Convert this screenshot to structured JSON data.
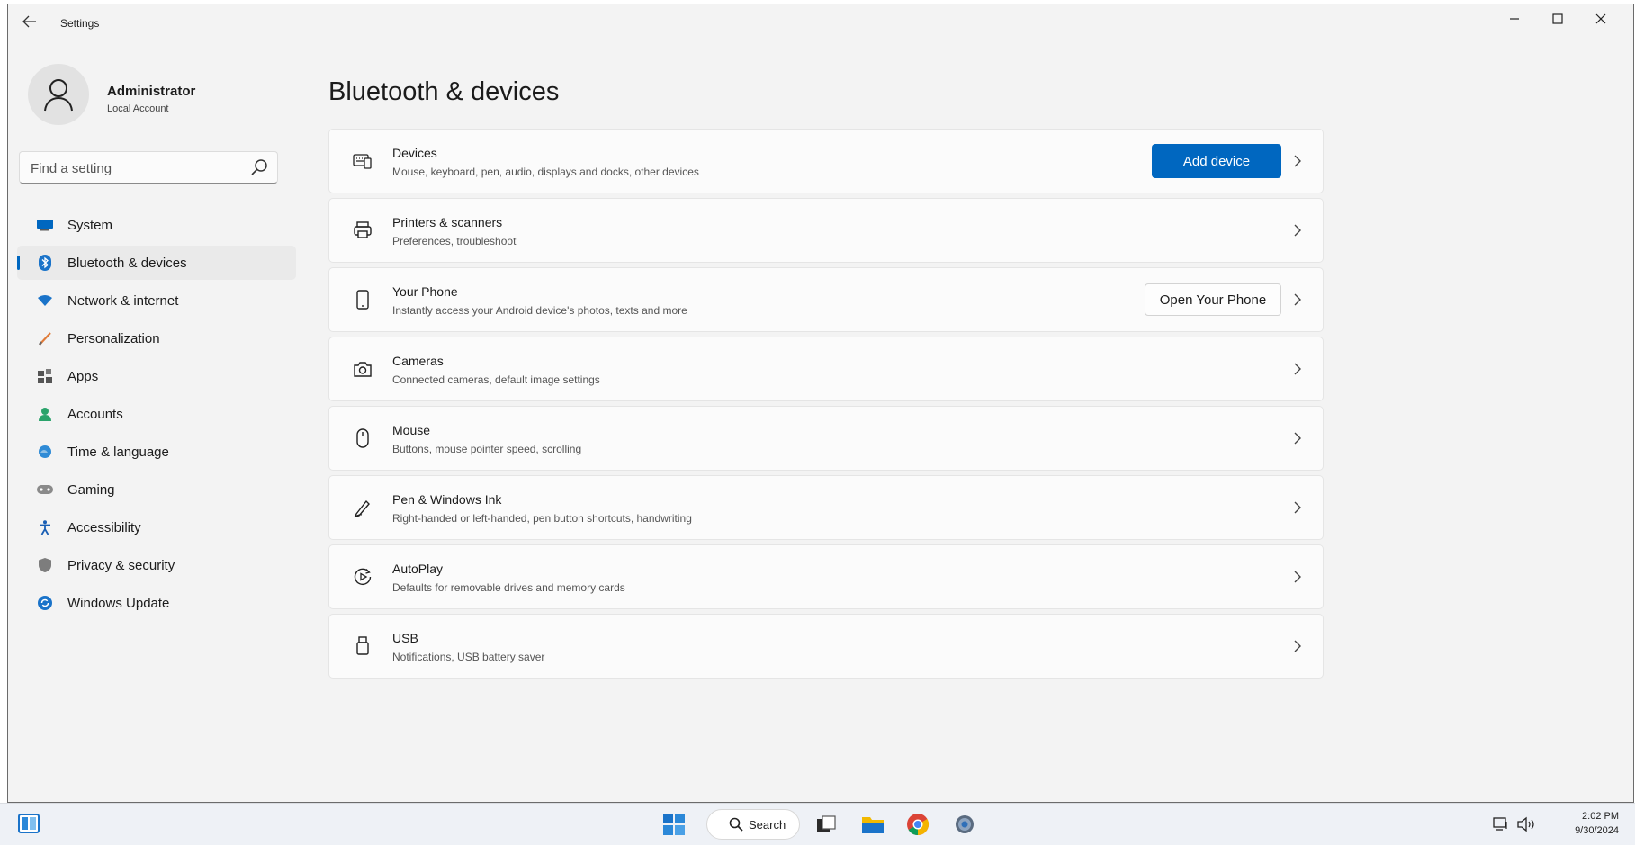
{
  "window": {
    "title": "Settings"
  },
  "profile": {
    "name": "Administrator",
    "subtitle": "Local Account"
  },
  "search": {
    "placeholder": "Find a setting"
  },
  "sidebar": {
    "items": [
      {
        "label": "System",
        "icon": "system-icon",
        "active": false
      },
      {
        "label": "Bluetooth & devices",
        "icon": "bluetooth-icon",
        "active": true
      },
      {
        "label": "Network & internet",
        "icon": "network-icon",
        "active": false
      },
      {
        "label": "Personalization",
        "icon": "personalization-icon",
        "active": false
      },
      {
        "label": "Apps",
        "icon": "apps-icon",
        "active": false
      },
      {
        "label": "Accounts",
        "icon": "accounts-icon",
        "active": false
      },
      {
        "label": "Time & language",
        "icon": "time-language-icon",
        "active": false
      },
      {
        "label": "Gaming",
        "icon": "gaming-icon",
        "active": false
      },
      {
        "label": "Accessibility",
        "icon": "accessibility-icon",
        "active": false
      },
      {
        "label": "Privacy & security",
        "icon": "privacy-icon",
        "active": false
      },
      {
        "label": "Windows Update",
        "icon": "windows-update-icon",
        "active": false
      }
    ]
  },
  "main": {
    "title": "Bluetooth & devices",
    "cards": [
      {
        "title": "Devices",
        "desc": "Mouse, keyboard, pen, audio, displays and docks, other devices",
        "icon": "devices-icon",
        "button": "Add device"
      },
      {
        "title": "Printers & scanners",
        "desc": "Preferences, troubleshoot",
        "icon": "printer-icon"
      },
      {
        "title": "Your Phone",
        "desc": "Instantly access your Android device's photos, texts and more",
        "icon": "phone-icon",
        "button": "Open Your Phone"
      },
      {
        "title": "Cameras",
        "desc": "Connected cameras, default image settings",
        "icon": "camera-icon"
      },
      {
        "title": "Mouse",
        "desc": "Buttons, mouse pointer speed, scrolling",
        "icon": "mouse-icon"
      },
      {
        "title": "Pen & Windows Ink",
        "desc": "Right-handed or left-handed, pen button shortcuts, handwriting",
        "icon": "pen-icon"
      },
      {
        "title": "AutoPlay",
        "desc": "Defaults for removable drives and memory cards",
        "icon": "autoplay-icon"
      },
      {
        "title": "USB",
        "desc": "Notifications, USB battery saver",
        "icon": "usb-icon"
      }
    ]
  },
  "taskbar": {
    "search_label": "Search",
    "time": "2:02 PM",
    "date": "9/30/2024"
  },
  "colors": {
    "accent": "#0067c0",
    "window_bg": "#f3f3f3",
    "card_bg": "#fbfbfb"
  }
}
